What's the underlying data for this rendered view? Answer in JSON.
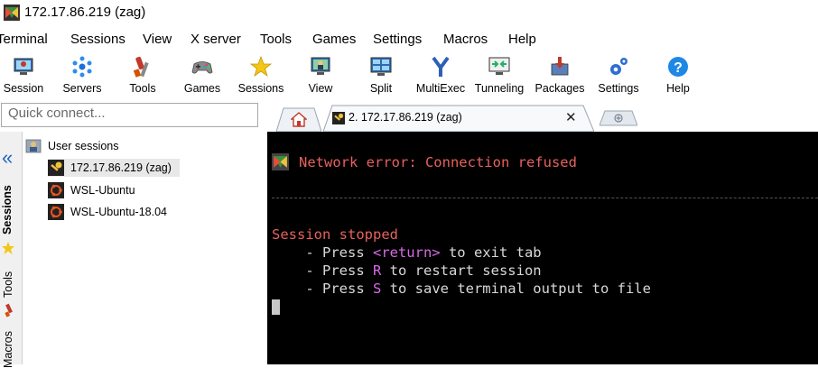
{
  "window": {
    "title": "172.17.86.219 (zag)"
  },
  "menu": [
    "Terminal",
    "Sessions",
    "View",
    "X server",
    "Tools",
    "Games",
    "Settings",
    "Macros",
    "Help"
  ],
  "toolbar": [
    {
      "label": "Session",
      "icon": "session-icon"
    },
    {
      "label": "Servers",
      "icon": "servers-icon"
    },
    {
      "label": "Tools",
      "icon": "tools-icon"
    },
    {
      "label": "Games",
      "icon": "games-icon"
    },
    {
      "label": "Sessions",
      "icon": "star-icon"
    },
    {
      "label": "View",
      "icon": "view-icon"
    },
    {
      "label": "Split",
      "icon": "split-icon"
    },
    {
      "label": "MultiExec",
      "icon": "multiexec-icon"
    },
    {
      "label": "Tunneling",
      "icon": "tunneling-icon"
    },
    {
      "label": "Packages",
      "icon": "packages-icon"
    },
    {
      "label": "Settings",
      "icon": "settings-icon"
    },
    {
      "label": "Help",
      "icon": "help-icon"
    }
  ],
  "quick_connect": {
    "placeholder": "Quick connect..."
  },
  "side_tabs": [
    "Sessions",
    "Tools",
    "Macros"
  ],
  "tree": {
    "root": "User sessions",
    "items": [
      "172.17.86.219 (zag)",
      "WSL-Ubuntu",
      "WSL-Ubuntu-18.04"
    ]
  },
  "tabs": {
    "active": "2. 172.17.86.219 (zag)",
    "close": "✕"
  },
  "terminal": {
    "error": "Network error: Connection refused",
    "stopped": "Session stopped",
    "press": "    - Press ",
    "ret_key": "<return>",
    "ret_rest": " to exit tab",
    "r_key": "R",
    "r_rest": " to restart session",
    "s_key": "S",
    "s_rest": " to save terminal output to file"
  },
  "colors": {
    "error_red": "#e8615d",
    "key_magenta": "#d86be6",
    "terminal_bg": "#000000"
  }
}
